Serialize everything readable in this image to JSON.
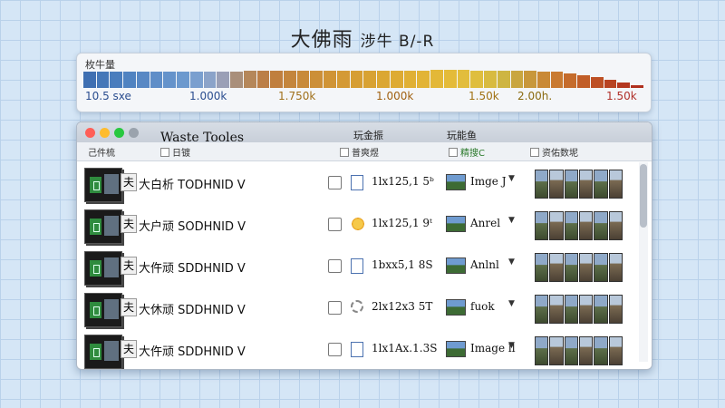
{
  "page": {
    "title": "大佛雨",
    "subtitle": "涉牛 B/-R"
  },
  "scale": {
    "label": "枚牛量",
    "ticks": [
      {
        "text": "10.5 sxe",
        "color": "#2a4d8f"
      },
      {
        "text": "1.000k",
        "color": "#2a4d8f"
      },
      {
        "text": "1.750k",
        "color": "#a0701a"
      },
      {
        "text": "1.000k",
        "color": "#a06010"
      },
      {
        "text": "1.50k",
        "color": "#a07010"
      },
      {
        "text": "2.00h.",
        "color": "#8a6a10"
      },
      {
        "text": "1.50k",
        "color": "#b0302a"
      }
    ],
    "bar_colors": [
      "#3f6fb2",
      "#4577b8",
      "#4a7dbd",
      "#5083c1",
      "#5888c4",
      "#5f8ec8",
      "#6593cb",
      "#6c99ce",
      "#7a9fcf",
      "#8ba3c9",
      "#9a9fb6",
      "#a98f7b",
      "#b5875a",
      "#bb7f48",
      "#c07f3e",
      "#c4853c",
      "#c88a3a",
      "#cc8f38",
      "#d09436",
      "#d49a35",
      "#d69e33",
      "#d8a233",
      "#dba733",
      "#deab33",
      "#e0b034",
      "#e2b436",
      "#e3b838",
      "#e4bb3a",
      "#e2bd3c",
      "#dfbe3e",
      "#d8bb40",
      "#ceb542",
      "#c9a63f",
      "#c8973b",
      "#c98936",
      "#c97a31",
      "#c56c2c",
      "#c15e28",
      "#bd5025",
      "#b84322",
      "#b43820",
      "#b0301e"
    ],
    "bar_levels": [
      0.8,
      0.8,
      0.8,
      0.8,
      0.8,
      0.8,
      0.8,
      0.8,
      0.8,
      0.8,
      0.8,
      0.82,
      0.85,
      0.85,
      0.85,
      0.85,
      0.85,
      0.85,
      0.85,
      0.85,
      0.85,
      0.85,
      0.85,
      0.85,
      0.85,
      0.87,
      0.9,
      0.9,
      0.9,
      0.85,
      0.85,
      0.85,
      0.85,
      0.85,
      0.82,
      0.8,
      0.72,
      0.65,
      0.55,
      0.4,
      0.28,
      0.15
    ]
  },
  "window": {
    "title": "Waste Tooles",
    "traffic": [
      "#ff5f57",
      "#febc2e",
      "#28c840",
      "#9aa3ad"
    ],
    "tabs": [
      "玩金振",
      "玩能鱼"
    ],
    "headers": [
      "己件梳",
      "日镀",
      "普爽煜",
      "精搜C",
      "资佑数坭"
    ]
  },
  "rows": [
    {
      "tag": "夫",
      "name": "大白析 TODHNID V",
      "icon": "file",
      "size": "1lx125,1 5ᵇ",
      "type_label": "Imge J"
    },
    {
      "tag": "夫",
      "name": "大户顽 SODHNID V",
      "icon": "sun",
      "size": "1lx125,1 9ᵗ",
      "type_label": "Anrel"
    },
    {
      "tag": "夫",
      "name": "大仵顽 SDDHNID V",
      "icon": "file",
      "size": "1bxx5,1 8S",
      "type_label": "Anlnl"
    },
    {
      "tag": "夫",
      "name": "大休顽 SDDHNID V",
      "icon": "gear",
      "size": "2lx12x3 5T",
      "type_label": "fuok"
    },
    {
      "tag": "夫",
      "name": "大仵顽 SDDHNID V",
      "icon": "file",
      "size": "1lx1Ax.1.3S",
      "type_label": "Image ll"
    }
  ]
}
